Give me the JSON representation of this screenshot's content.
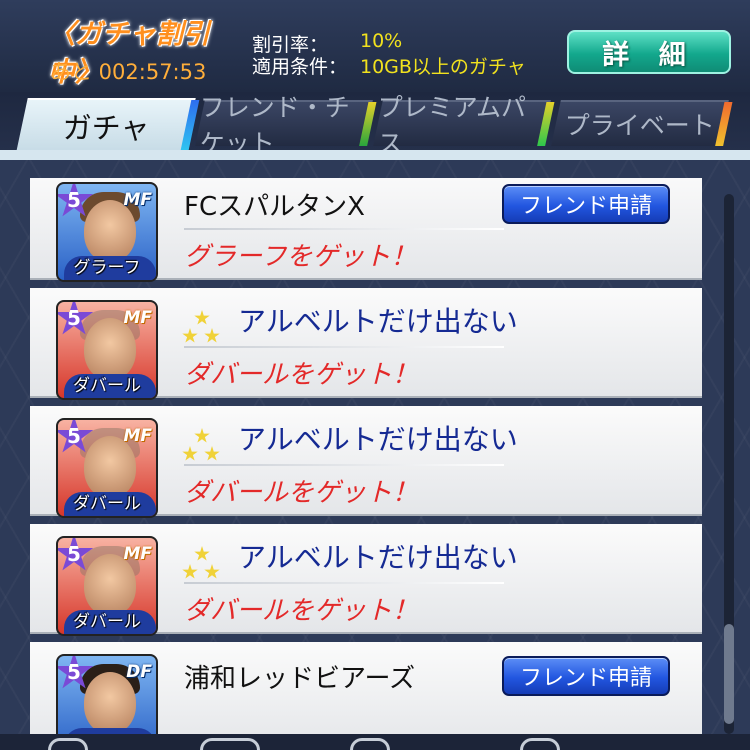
{
  "header": {
    "discount_badge": "〈ガチャ割引中〉",
    "timer": "あと 002:57:53",
    "rate_label": "割引率：",
    "rate_value": "10%",
    "condition_label": "適用条件：",
    "condition_value": "10GB以上のガチャ",
    "detail_button": "詳 細"
  },
  "tabs": [
    {
      "label": "ガチャ",
      "active": true
    },
    {
      "label": "フレンド・チケット",
      "active": false
    },
    {
      "label": "プレミアムパス",
      "active": false
    },
    {
      "label": "プライベート",
      "active": false
    }
  ],
  "list": [
    {
      "team": "FCスパルタンX",
      "player": "グラーフ",
      "result": "グラーフをゲット！",
      "rarity": "5",
      "position": "MF",
      "card_color": "blue",
      "has_friend_button": true,
      "has_stars": false
    },
    {
      "team": "アルベルトだけ出ない",
      "player": "ダバール",
      "result": "ダバールをゲット！",
      "rarity": "5",
      "position": "MF",
      "card_color": "red",
      "has_friend_button": false,
      "has_stars": true
    },
    {
      "team": "アルベルトだけ出ない",
      "player": "ダバール",
      "result": "ダバールをゲット！",
      "rarity": "5",
      "position": "MF",
      "card_color": "red",
      "has_friend_button": false,
      "has_stars": true
    },
    {
      "team": "アルベルトだけ出ない",
      "player": "ダバール",
      "result": "ダバールをゲット！",
      "rarity": "5",
      "position": "MF",
      "card_color": "red",
      "has_friend_button": false,
      "has_stars": true
    },
    {
      "team": "浦和レッドビアーズ",
      "player": "",
      "result": "",
      "rarity": "5",
      "position": "DF",
      "card_color": "blue",
      "has_friend_button": true,
      "has_stars": false
    }
  ],
  "friend_button_label": "フレンド申請",
  "icons": [
    "star-rank-icon",
    "stars-icon",
    "home-icon",
    "chat-icon",
    "friends-icon",
    "edit-icon"
  ]
}
